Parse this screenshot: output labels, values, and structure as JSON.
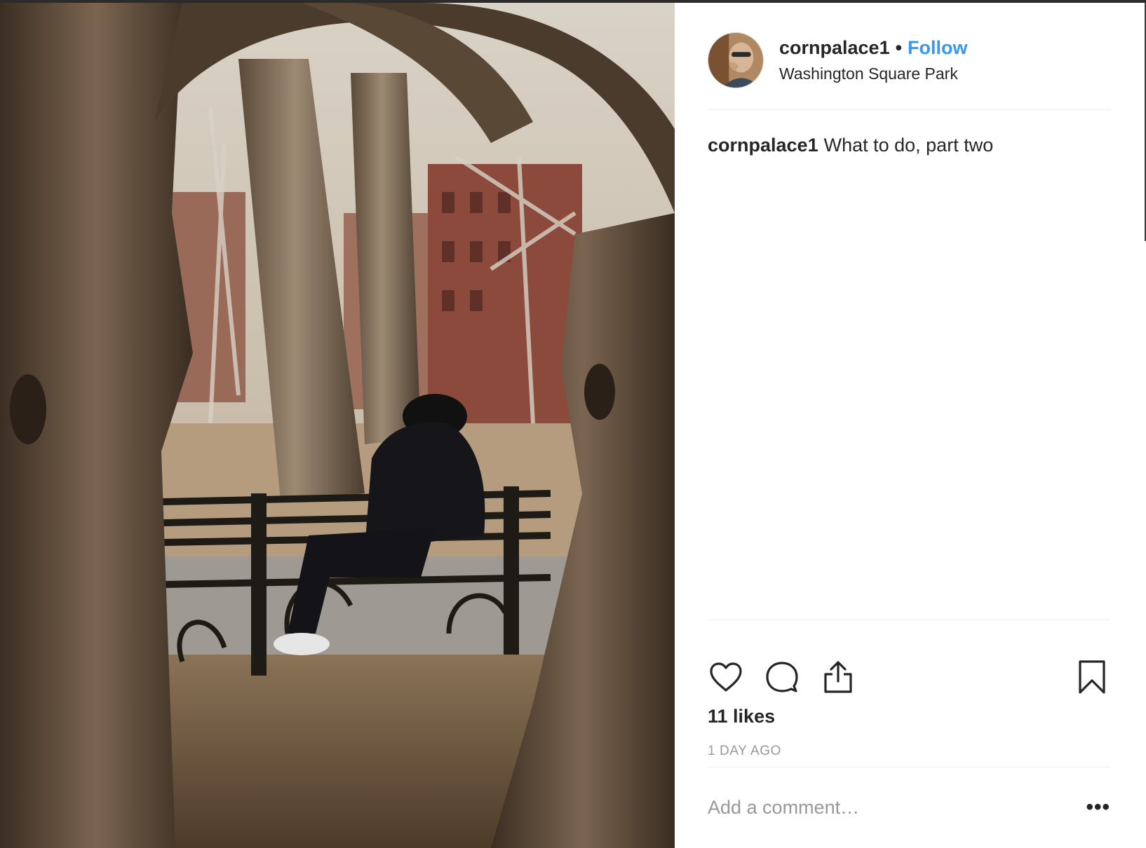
{
  "post": {
    "username": "cornpalace1",
    "separator": "•",
    "follow_label": "Follow",
    "location": "Washington Square Park",
    "caption_user": "cornpalace1",
    "caption_text": "What to do, part two",
    "likes": "11 likes",
    "time": "1 DAY AGO",
    "comment_placeholder": "Add a comment…",
    "more_label": "•••"
  },
  "icons": {
    "like": "heart-icon",
    "comment": "speech-bubble-icon",
    "share": "share-upload-icon",
    "save": "bookmark-icon"
  },
  "colors": {
    "follow_blue": "#3897f0",
    "text": "#262626",
    "muted": "#999999",
    "divider": "#efefef"
  }
}
